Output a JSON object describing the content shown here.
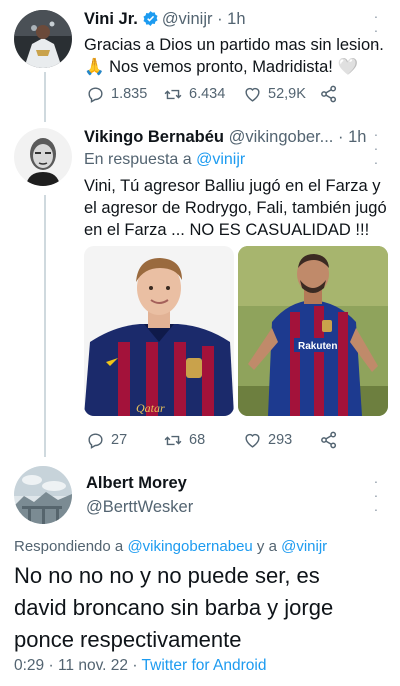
{
  "tweet1": {
    "name": "Vini Jr.",
    "handle": "@vinijr",
    "time": "· 1h",
    "line1": "Gracias a Dios un partido mas sin lesion.",
    "line2": "🙏  Nos vemos pronto, Madridista! 🤍",
    "replies": "1.835",
    "retweets": "6.434",
    "likes": "52,9K"
  },
  "tweet2": {
    "name": "Vikingo Bernabéu",
    "handle": "@vikingober...",
    "time": "· 1h",
    "reply_prefix": "En respuesta a",
    "reply_user": "@vinijr",
    "line1": "Vini, Tú agresor Balliu jugó en el Farza y",
    "line2": "el agresor de Rodrygo, Fali, también jugó",
    "line3": "en el Farza ...  NO ES CASUALIDAD !!!",
    "replies": "27",
    "retweets": "68",
    "likes": "293",
    "photo1_text": "Qatar",
    "photo2_text": "Rakuten"
  },
  "tweet3": {
    "name": "Albert Morey",
    "handle": "@BerttWesker",
    "reply_prefix": "Respondiendo a",
    "reply_user1": "@vikingobernabeu",
    "reply_join": "y a",
    "reply_user2": "@vinijr",
    "line1": "No no no no y no puede ser, es",
    "line2": "david broncano sin barba y jorge",
    "line3": "ponce respectivamente",
    "timestamp": "0:29 · 11 nov. 22 ·",
    "source": "Twitter for Android"
  },
  "colors": {
    "accent": "#1d9bf0",
    "muted": "#536471",
    "text": "#0f1419",
    "thread": "#cfd9de"
  },
  "icons": [
    "verified-badge-icon",
    "reply-icon",
    "retweet-icon",
    "like-icon",
    "share-icon",
    "more-icon"
  ]
}
